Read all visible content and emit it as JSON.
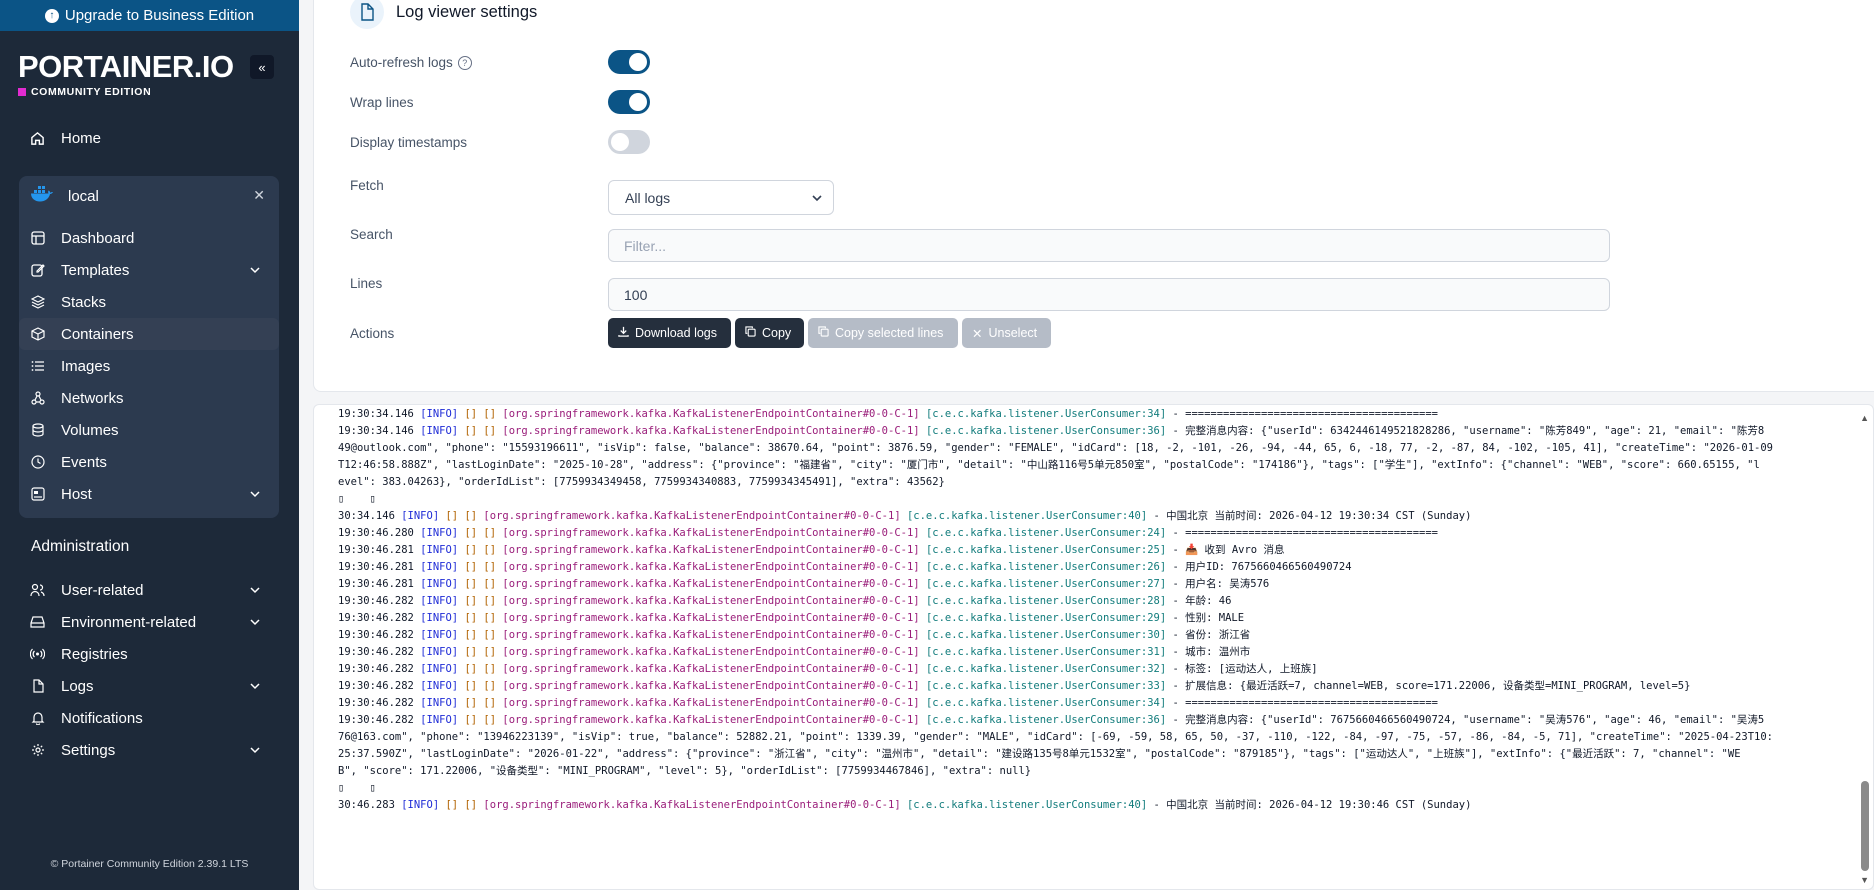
{
  "sidebar": {
    "upgrade_label": "Upgrade to Business Edition",
    "logo_text": "PORTAINER.IO",
    "edition_text": "COMMUNITY EDITION",
    "home_label": "Home",
    "environment": {
      "name": "local",
      "items": [
        {
          "label": "Dashboard",
          "icon": "dashboard-icon"
        },
        {
          "label": "Templates",
          "icon": "edit-icon",
          "has_chevron": true
        },
        {
          "label": "Stacks",
          "icon": "layers-icon"
        },
        {
          "label": "Containers",
          "icon": "box-icon",
          "active": true
        },
        {
          "label": "Images",
          "icon": "list-icon"
        },
        {
          "label": "Networks",
          "icon": "network-icon"
        },
        {
          "label": "Volumes",
          "icon": "database-icon"
        },
        {
          "label": "Events",
          "icon": "clock-icon"
        },
        {
          "label": "Host",
          "icon": "server-icon",
          "has_chevron": true
        }
      ]
    },
    "administration_title": "Administration",
    "admin_items": [
      {
        "label": "User-related",
        "icon": "users-icon",
        "has_chevron": true
      },
      {
        "label": "Environment-related",
        "icon": "drive-icon",
        "has_chevron": true
      },
      {
        "label": "Registries",
        "icon": "radio-icon"
      },
      {
        "label": "Logs",
        "icon": "file-icon",
        "has_chevron": true
      },
      {
        "label": "Notifications",
        "icon": "bell-icon"
      },
      {
        "label": "Settings",
        "icon": "gear-icon",
        "has_chevron": true
      }
    ],
    "footer": "© Portainer Community Edition 2.39.1 LTS"
  },
  "settings": {
    "title": "Log viewer settings",
    "auto_refresh_label": "Auto-refresh logs",
    "auto_refresh_on": true,
    "wrap_lines_label": "Wrap lines",
    "wrap_lines_on": true,
    "timestamps_label": "Display timestamps",
    "timestamps_on": false,
    "fetch_label": "Fetch",
    "fetch_value": "All logs",
    "search_label": "Search",
    "search_placeholder": "Filter...",
    "lines_label": "Lines",
    "lines_value": "100",
    "actions_label": "Actions",
    "download_label": "Download logs",
    "copy_label": "Copy",
    "copy_selected_label": "Copy selected lines",
    "unselect_label": "Unselect"
  },
  "colors": {
    "accent": "#0b5486",
    "sidebar_bg": "#1d2939",
    "log_info": "#1e2bd6",
    "log_class": "#9a1d7a",
    "log_source": "#127c7c"
  },
  "log": {
    "lines": [
      {
        "ts": "19:30:34.146",
        "lvl": "[INFO]",
        "br": "[] []",
        "cls": "[org.springframework.kafka.KafkaListenerEndpointContainer#0-0-C-1]",
        "src": "[c.e.c.kafka.listener.UserConsumer:34]",
        "msg": "- ========================================"
      },
      {
        "ts": "19:30:34.146",
        "lvl": "[INFO]",
        "br": "[] []",
        "cls": "[org.springframework.kafka.KafkaListenerEndpointContainer#0-0-C-1]",
        "src": "[c.e.c.kafka.listener.UserConsumer:36]",
        "msg": "- 完整消息内容: {\"userId\": 6342446149521828286, \"username\": \"陈芳849\", \"age\": 21, \"email\": \"陈芳8"
      },
      {
        "ts": "",
        "lvl": "",
        "br": "",
        "cls": "",
        "src": "",
        "msg": "49@outlook.com\", \"phone\": \"15593196611\", \"isVip\": false, \"balance\": 38670.64, \"point\": 3876.59, \"gender\": \"FEMALE\", \"idCard\": [18, -2, -101, -26, -94, -44, 65, 6, -18, 77, -2, -87, 84, -102, -105, 41], \"createTime\": \"2026-01-09"
      },
      {
        "ts": "",
        "lvl": "",
        "br": "",
        "cls": "",
        "src": "",
        "msg": "T12:46:58.888Z\", \"lastLoginDate\": \"2025-10-28\", \"address\": {\"province\": \"福建省\", \"city\": \"厦门市\", \"detail\": \"中山路116号5单元850室\", \"postalCode\": \"174186\"}, \"tags\": [\"学生\"], \"extInfo\": {\"channel\": \"WEB\", \"score\": 660.65155, \"l"
      },
      {
        "ts": "",
        "lvl": "",
        "br": "",
        "cls": "",
        "src": "",
        "msg": "evel\": 383.04263}, \"orderIdList\": [7759934349458, 7759934340883, 7759934345491], \"extra\": 43562}"
      },
      {
        "ts": "",
        "lvl": "",
        "br": "",
        "cls": "",
        "src": "",
        "msg": "▯    ▯"
      },
      {
        "ts": "30:34.146",
        "lvl": "[INFO]",
        "br": "[] []",
        "cls": "[org.springframework.kafka.KafkaListenerEndpointContainer#0-0-C-1]",
        "src": "[c.e.c.kafka.listener.UserConsumer:40]",
        "msg": "- 中国北京 当前时间: 2026-04-12 19:30:34 CST (Sunday)"
      },
      {
        "ts": "19:30:46.280",
        "lvl": "[INFO]",
        "br": "[] []",
        "cls": "[org.springframework.kafka.KafkaListenerEndpointContainer#0-0-C-1]",
        "src": "[c.e.c.kafka.listener.UserConsumer:24]",
        "msg": "- ========================================"
      },
      {
        "ts": "19:30:46.281",
        "lvl": "[INFO]",
        "br": "[] []",
        "cls": "[org.springframework.kafka.KafkaListenerEndpointContainer#0-0-C-1]",
        "src": "[c.e.c.kafka.listener.UserConsumer:25]",
        "msg": "- 📥 收到 Avro 消息"
      },
      {
        "ts": "19:30:46.281",
        "lvl": "[INFO]",
        "br": "[] []",
        "cls": "[org.springframework.kafka.KafkaListenerEndpointContainer#0-0-C-1]",
        "src": "[c.e.c.kafka.listener.UserConsumer:26]",
        "msg": "- 用户ID: 7675660466560490724"
      },
      {
        "ts": "19:30:46.281",
        "lvl": "[INFO]",
        "br": "[] []",
        "cls": "[org.springframework.kafka.KafkaListenerEndpointContainer#0-0-C-1]",
        "src": "[c.e.c.kafka.listener.UserConsumer:27]",
        "msg": "- 用户名: 吴涛576"
      },
      {
        "ts": "19:30:46.282",
        "lvl": "[INFO]",
        "br": "[] []",
        "cls": "[org.springframework.kafka.KafkaListenerEndpointContainer#0-0-C-1]",
        "src": "[c.e.c.kafka.listener.UserConsumer:28]",
        "msg": "- 年龄: 46"
      },
      {
        "ts": "19:30:46.282",
        "lvl": "[INFO]",
        "br": "[] []",
        "cls": "[org.springframework.kafka.KafkaListenerEndpointContainer#0-0-C-1]",
        "src": "[c.e.c.kafka.listener.UserConsumer:29]",
        "msg": "- 性别: MALE"
      },
      {
        "ts": "19:30:46.282",
        "lvl": "[INFO]",
        "br": "[] []",
        "cls": "[org.springframework.kafka.KafkaListenerEndpointContainer#0-0-C-1]",
        "src": "[c.e.c.kafka.listener.UserConsumer:30]",
        "msg": "- 省份: 浙江省"
      },
      {
        "ts": "19:30:46.282",
        "lvl": "[INFO]",
        "br": "[] []",
        "cls": "[org.springframework.kafka.KafkaListenerEndpointContainer#0-0-C-1]",
        "src": "[c.e.c.kafka.listener.UserConsumer:31]",
        "msg": "- 城市: 温州市"
      },
      {
        "ts": "19:30:46.282",
        "lvl": "[INFO]",
        "br": "[] []",
        "cls": "[org.springframework.kafka.KafkaListenerEndpointContainer#0-0-C-1]",
        "src": "[c.e.c.kafka.listener.UserConsumer:32]",
        "msg": "- 标签: [运动达人, 上班族]"
      },
      {
        "ts": "19:30:46.282",
        "lvl": "[INFO]",
        "br": "[] []",
        "cls": "[org.springframework.kafka.KafkaListenerEndpointContainer#0-0-C-1]",
        "src": "[c.e.c.kafka.listener.UserConsumer:33]",
        "msg": "- 扩展信息: {最近活跃=7, channel=WEB, score=171.22006, 设备类型=MINI_PROGRAM, level=5}"
      },
      {
        "ts": "19:30:46.282",
        "lvl": "[INFO]",
        "br": "[] []",
        "cls": "[org.springframework.kafka.KafkaListenerEndpointContainer#0-0-C-1]",
        "src": "[c.e.c.kafka.listener.UserConsumer:34]",
        "msg": "- ========================================"
      },
      {
        "ts": "19:30:46.282",
        "lvl": "[INFO]",
        "br": "[] []",
        "cls": "[org.springframework.kafka.KafkaListenerEndpointContainer#0-0-C-1]",
        "src": "[c.e.c.kafka.listener.UserConsumer:36]",
        "msg": "- 完整消息内容: {\"userId\": 7675660466560490724, \"username\": \"吴涛576\", \"age\": 46, \"email\": \"吴涛5"
      },
      {
        "ts": "",
        "lvl": "",
        "br": "",
        "cls": "",
        "src": "",
        "msg": "76@163.com\", \"phone\": \"13946223139\", \"isVip\": true, \"balance\": 52882.21, \"point\": 1339.39, \"gender\": \"MALE\", \"idCard\": [-69, -59, 58, 65, 50, -37, -110, -122, -84, -97, -75, -57, -86, -84, -5, 71], \"createTime\": \"2025-04-23T10:"
      },
      {
        "ts": "",
        "lvl": "",
        "br": "",
        "cls": "",
        "src": "",
        "msg": "25:37.590Z\", \"lastLoginDate\": \"2026-01-22\", \"address\": {\"province\": \"浙江省\", \"city\": \"温州市\", \"detail\": \"建设路135号8单元1532室\", \"postalCode\": \"879185\"}, \"tags\": [\"运动达人\", \"上班族\"], \"extInfo\": {\"最近活跃\": 7, \"channel\": \"WE"
      },
      {
        "ts": "",
        "lvl": "",
        "br": "",
        "cls": "",
        "src": "",
        "msg": "B\", \"score\": 171.22006, \"设备类型\": \"MINI_PROGRAM\", \"level\": 5}, \"orderIdList\": [7759934467846], \"extra\": null}"
      },
      {
        "ts": "",
        "lvl": "",
        "br": "",
        "cls": "",
        "src": "",
        "msg": "▯    ▯"
      },
      {
        "ts": "30:46.283",
        "lvl": "[INFO]",
        "br": "[] []",
        "cls": "[org.springframework.kafka.KafkaListenerEndpointContainer#0-0-C-1]",
        "src": "[c.e.c.kafka.listener.UserConsumer:40]",
        "msg": "- 中国北京 当前时间: 2026-04-12 19:30:46 CST (Sunday)"
      }
    ]
  }
}
